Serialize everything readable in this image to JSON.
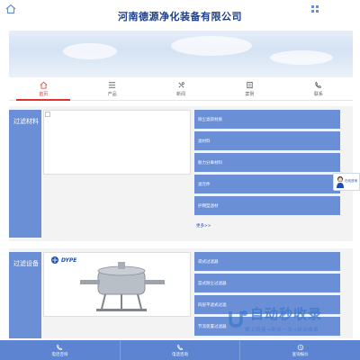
{
  "header": {
    "title": "河南德源净化装备有限公司",
    "home_icon": "home-icon",
    "menu_icon": "menu-icon"
  },
  "nav": {
    "items": [
      {
        "label": "首页",
        "icon": "home-icon",
        "active": true
      },
      {
        "label": "产品",
        "icon": "list-icon",
        "active": false
      },
      {
        "label": "新闻",
        "icon": "news-icon",
        "active": false
      },
      {
        "label": "案例",
        "icon": "case-icon",
        "active": false
      },
      {
        "label": "联系",
        "icon": "contact-icon",
        "active": false
      }
    ]
  },
  "sections": [
    {
      "label": "过滤材料",
      "items": [
        "除尘滤袋材质",
        "滤材料",
        "耐力分离材料",
        "滤元件",
        "护网型滤材"
      ],
      "more": "更多>>"
    },
    {
      "label": "过滤设备",
      "brand": "DYPE",
      "items": [
        "袋式过滤器",
        "篮式除尘过滤器",
        "四层平滤式过滤",
        "节流装置过滤器"
      ]
    }
  ],
  "chat": {
    "label": "在线咨询"
  },
  "watermark": {
    "text": "自动秒收录",
    "slogan": "做上链接→来访一次→自动收录"
  },
  "footer": {
    "items": [
      {
        "label": "电话咨询",
        "icon": "phone-icon"
      },
      {
        "label": "电话咨询",
        "icon": "phone-icon"
      },
      {
        "label": "查询报价",
        "icon": "inquiry-icon"
      }
    ]
  },
  "colors": {
    "accent": "#6a8fd6",
    "title": "#1d3f8f",
    "active": "#dd3333",
    "footer": "#5d84d0"
  }
}
